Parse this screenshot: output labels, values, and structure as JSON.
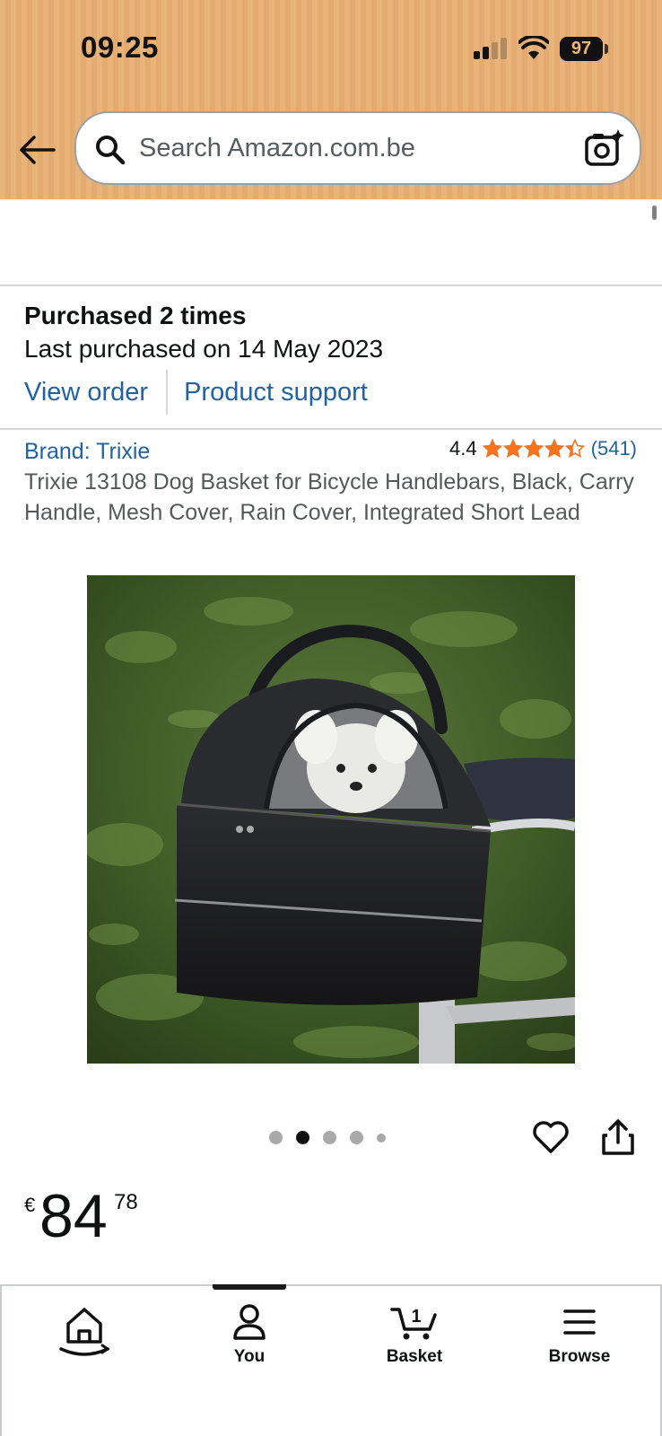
{
  "status_bar": {
    "time": "09:25",
    "battery": "97"
  },
  "search": {
    "placeholder": "Search Amazon.com.be"
  },
  "purchase_history": {
    "title": "Purchased 2 times",
    "last_purchased": "Last purchased on 14 May 2023",
    "view_order_label": "View order",
    "product_support_label": "Product support"
  },
  "product": {
    "brand_label": "Brand: Trixie",
    "rating_value": "4.4",
    "rating_stars": 4.4,
    "rating_count": "(541)",
    "title": "Trixie 13108 Dog Basket for Bicycle Handlebars, Black, Carry Handle, Mesh Cover, Rain Cover, Integrated Short Lead",
    "image_count": 5,
    "active_image_index": 1,
    "price": {
      "currency": "€",
      "whole": "84",
      "fraction": "78"
    }
  },
  "bottom_nav": {
    "items": [
      {
        "label": "",
        "icon": "home-icon"
      },
      {
        "label": "You",
        "icon": "person-icon"
      },
      {
        "label": "Basket",
        "icon": "cart-icon",
        "badge": "1"
      },
      {
        "label": "Browse",
        "icon": "menu-icon"
      }
    ],
    "active_index": 1
  },
  "colors": {
    "header_bg": "#e9b47a",
    "link": "#2162a1",
    "star": "#f4731f",
    "text": "#0f1111"
  }
}
